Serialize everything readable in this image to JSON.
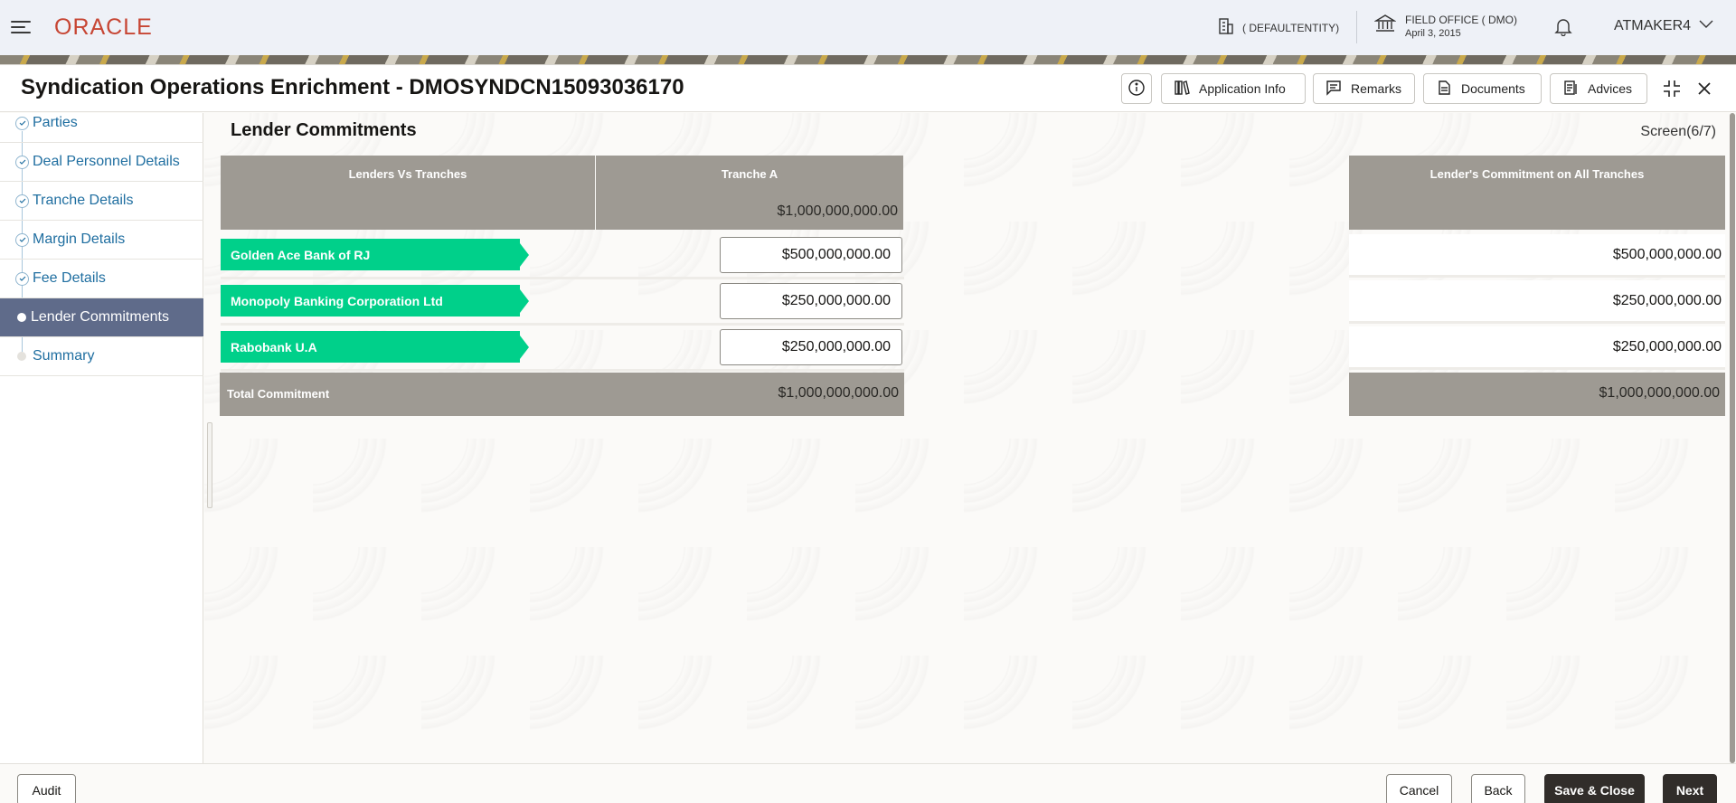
{
  "topbar": {
    "logo": "ORACLE",
    "entity": "( DEFAULTENTITY)",
    "office_name": "FIELD OFFICE ( DMO)",
    "office_date": "April 3, 2015",
    "user": "ATMAKER4"
  },
  "window": {
    "title": "Syndication Operations Enrichment - DMOSYNDCN15093036170",
    "buttons": {
      "app_info": "Application Info",
      "remarks": "Remarks",
      "documents": "Documents",
      "advices": "Advices"
    }
  },
  "sidebar": {
    "items": [
      {
        "label": "Parties",
        "state": "done"
      },
      {
        "label": "Deal Personnel Details",
        "state": "done"
      },
      {
        "label": "Tranche Details",
        "state": "done"
      },
      {
        "label": "Margin Details",
        "state": "done"
      },
      {
        "label": "Fee Details",
        "state": "done"
      },
      {
        "label": "Lender Commitments",
        "state": "active"
      },
      {
        "label": "Summary",
        "state": "pending"
      }
    ]
  },
  "main": {
    "section_title": "Lender Commitments",
    "screen_indicator": "Screen(6/7)",
    "table": {
      "col_lenders": "Lenders Vs Tranches",
      "col_tranche": "Tranche A",
      "tranche_amount": "$1,000,000,000.00",
      "col_all": "Lender's Commitment on All Tranches",
      "rows": [
        {
          "lender": "Golden Ace Bank of RJ",
          "tranche_a": "$500,000,000.00",
          "all": "$500,000,000.00"
        },
        {
          "lender": "Monopoly Banking Corporation Ltd",
          "tranche_a": "$250,000,000.00",
          "all": "$250,000,000.00"
        },
        {
          "lender": "Rabobank U.A",
          "tranche_a": "$250,000,000.00",
          "all": "$250,000,000.00"
        }
      ],
      "total_label": "Total Commitment",
      "total_tranche": "$1,000,000,000.00",
      "total_all": "$1,000,000,000.00"
    }
  },
  "footer": {
    "audit": "Audit",
    "cancel": "Cancel",
    "back": "Back",
    "save_close": "Save & Close",
    "next": "Next"
  },
  "colors": {
    "lender_badge": "#00d08a",
    "header_gray": "#9e9a93",
    "active_nav": "#5f6b8a",
    "brand": "#c74634"
  }
}
